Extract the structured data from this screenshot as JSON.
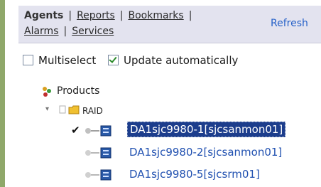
{
  "nav": {
    "agents": "Agents",
    "reports": "Reports",
    "bookmarks": "Bookmarks",
    "alarms": "Alarms",
    "services": "Services",
    "separator": "|",
    "refresh": "Refresh"
  },
  "options": {
    "multiselect": {
      "label": "Multiselect",
      "checked": false
    },
    "update_auto": {
      "label": "Update automatically",
      "checked": true
    }
  },
  "tree": {
    "root": {
      "label": "Products",
      "icon": "products-icon"
    },
    "group": {
      "label": "RAID",
      "icon": "folder-icon",
      "expanded": true
    },
    "servers": [
      {
        "label": "DA1sjc9980-1[sjcsanmon01]",
        "selected": true,
        "checked": true
      },
      {
        "label": "DA1sjc9980-2[sjcsanmon01]",
        "selected": false,
        "checked": false
      },
      {
        "label": "DA1sjc9980-5[sjcsrm01]",
        "selected": false,
        "checked": false
      }
    ]
  },
  "colors": {
    "nav_bg": "#e3e3ef",
    "link_blue": "#2050b0",
    "selected_bg": "#1c3d8c",
    "rail_green": "#8fa86a"
  }
}
